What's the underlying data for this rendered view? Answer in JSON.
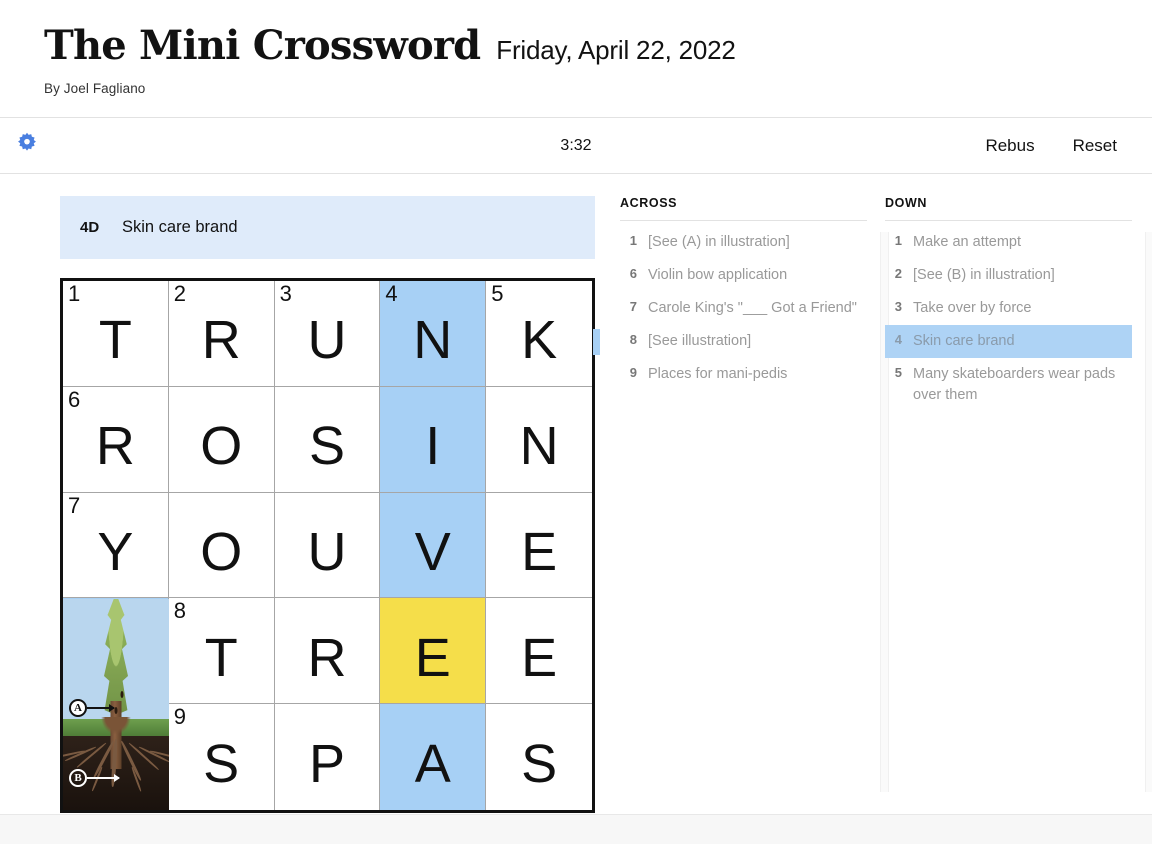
{
  "header": {
    "title": "The Mini Crossword",
    "date": "Friday, April 22, 2022",
    "byline": "By Joel Fagliano"
  },
  "toolbar": {
    "settings_icon": "gear-icon",
    "settings_color": "#4a7fe0",
    "timer": "3:32",
    "rebus_label": "Rebus",
    "reset_label": "Reset"
  },
  "current_clue": {
    "number": "4D",
    "text": "Skin care brand",
    "background": "#dfebfa"
  },
  "colors": {
    "cell_highlight": "#a7d0f5",
    "cell_active": "#f5de4a",
    "clue_selected": "#aed3f5"
  },
  "grid": {
    "rows": 5,
    "cols": 5,
    "cells": [
      {
        "num": "1",
        "letter": "T",
        "state": "normal"
      },
      {
        "num": "2",
        "letter": "R",
        "state": "normal"
      },
      {
        "num": "3",
        "letter": "U",
        "state": "normal"
      },
      {
        "num": "4",
        "letter": "N",
        "state": "highlight"
      },
      {
        "num": "5",
        "letter": "K",
        "state": "normal"
      },
      {
        "num": "6",
        "letter": "R",
        "state": "normal"
      },
      {
        "num": "",
        "letter": "O",
        "state": "normal"
      },
      {
        "num": "",
        "letter": "S",
        "state": "normal"
      },
      {
        "num": "",
        "letter": "I",
        "state": "highlight"
      },
      {
        "num": "",
        "letter": "N",
        "state": "normal"
      },
      {
        "num": "7",
        "letter": "Y",
        "state": "normal"
      },
      {
        "num": "",
        "letter": "O",
        "state": "normal"
      },
      {
        "num": "",
        "letter": "U",
        "state": "normal"
      },
      {
        "num": "",
        "letter": "V",
        "state": "highlight"
      },
      {
        "num": "",
        "letter": "E",
        "state": "normal"
      },
      {
        "num": "",
        "letter": "",
        "state": "highlight"
      },
      {
        "num": "8",
        "letter": "T",
        "state": "normal"
      },
      {
        "num": "",
        "letter": "R",
        "state": "normal"
      },
      {
        "num": "",
        "letter": "E",
        "state": "active"
      },
      {
        "num": "",
        "letter": "E",
        "state": "normal"
      },
      {
        "num": "",
        "letter": "",
        "state": "normal"
      },
      {
        "num": "9",
        "letter": "S",
        "state": "normal"
      },
      {
        "num": "",
        "letter": "P",
        "state": "normal"
      },
      {
        "num": "",
        "letter": "A",
        "state": "highlight"
      },
      {
        "num": "",
        "letter": "S",
        "state": "normal"
      }
    ]
  },
  "illustration": {
    "label_a": "A",
    "label_b": "B"
  },
  "across": {
    "heading": "ACROSS",
    "clues": [
      {
        "num": "1",
        "text": "[See (A) in illustration]",
        "selected": false,
        "marked": false
      },
      {
        "num": "6",
        "text": "Violin bow application",
        "selected": false,
        "marked": false
      },
      {
        "num": "7",
        "text": "Carole King's \"___ Got a Friend\"",
        "selected": false,
        "marked": false
      },
      {
        "num": "8",
        "text": "[See illustration]",
        "selected": false,
        "marked": true
      },
      {
        "num": "9",
        "text": "Places for mani-pedis",
        "selected": false,
        "marked": false
      }
    ]
  },
  "down": {
    "heading": "DOWN",
    "clues": [
      {
        "num": "1",
        "text": "Make an attempt",
        "selected": false,
        "marked": false
      },
      {
        "num": "2",
        "text": "[See (B) in illustration]",
        "selected": false,
        "marked": false
      },
      {
        "num": "3",
        "text": "Take over by force",
        "selected": false,
        "marked": false
      },
      {
        "num": "4",
        "text": "Skin care brand",
        "selected": true,
        "marked": false
      },
      {
        "num": "5",
        "text": "Many skateboarders wear pads over them",
        "selected": false,
        "marked": false
      }
    ]
  }
}
